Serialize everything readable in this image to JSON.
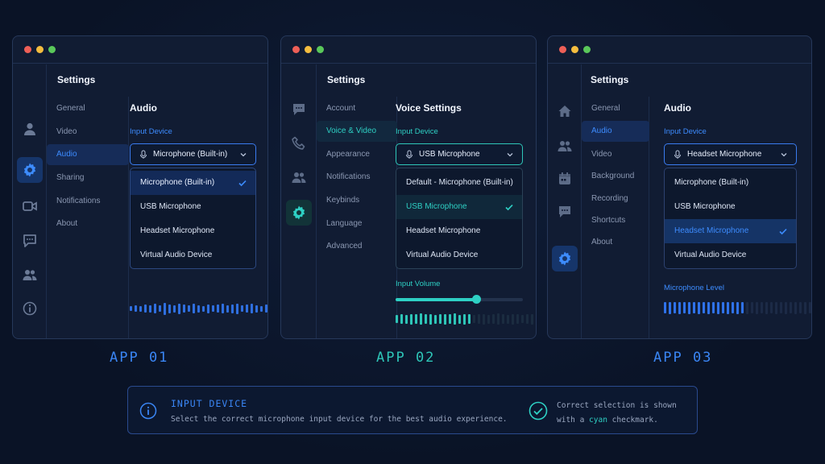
{
  "windows": [
    {
      "settings_title": "Settings",
      "nav": [
        "General",
        "Video",
        "Audio",
        "Sharing",
        "Notifications",
        "About"
      ],
      "selected_nav": "Audio",
      "pane_title": "Audio",
      "field_label": "Input Device",
      "selected_value": "Microphone (Built-in)",
      "options": [
        "Microphone (Built-in)",
        "USB Microphone",
        "Headset Microphone",
        "Virtual Audio Device"
      ],
      "checked_option": "Microphone (Built-in)"
    },
    {
      "settings_title": "Settings",
      "nav": [
        "Account",
        "Voice & Video",
        "Appearance",
        "Notifications",
        "Keybinds",
        "Language",
        "Advanced"
      ],
      "selected_nav": "Voice & Video",
      "pane_title": "Voice Settings",
      "field_label": "Input Device",
      "selected_value": "USB Microphone",
      "options": [
        "Default - Microphone (Built-in)",
        "USB Microphone",
        "Headset Microphone",
        "Virtual Audio Device"
      ],
      "checked_option": "USB Microphone",
      "volume_label": "Input Volume",
      "volume_level": 0.63
    },
    {
      "settings_title": "Settings",
      "nav": [
        "General",
        "Audio",
        "Video",
        "Background",
        "Recording",
        "Shortcuts",
        "About"
      ],
      "selected_nav": "Audio",
      "pane_title": "Audio",
      "field_label": "Input Device",
      "selected_value": "Headset Microphone",
      "options": [
        "Microphone (Built-in)",
        "USB Microphone",
        "Headset Microphone",
        "Virtual Audio Device"
      ],
      "checked_option": "Headset Microphone",
      "level_label": "Microphone Level"
    }
  ],
  "app_labels": [
    "APP 01",
    "APP 02",
    "APP 03"
  ],
  "info": {
    "title": "INPUT DEVICE",
    "text": "Select the correct microphone input device for the best audio experience.",
    "note_line1": "Correct selection is shown",
    "note_line2_prefix": "with a ",
    "note_line2_highlight": "cyan",
    "note_line2_suffix": " checkmark."
  },
  "colors": {
    "accent_blue": "#3d8cff",
    "accent_cyan": "#2ed0c4",
    "dot_red": "#ee5f57",
    "dot_yellow": "#f5bd3f",
    "dot_green": "#5ac85a"
  }
}
